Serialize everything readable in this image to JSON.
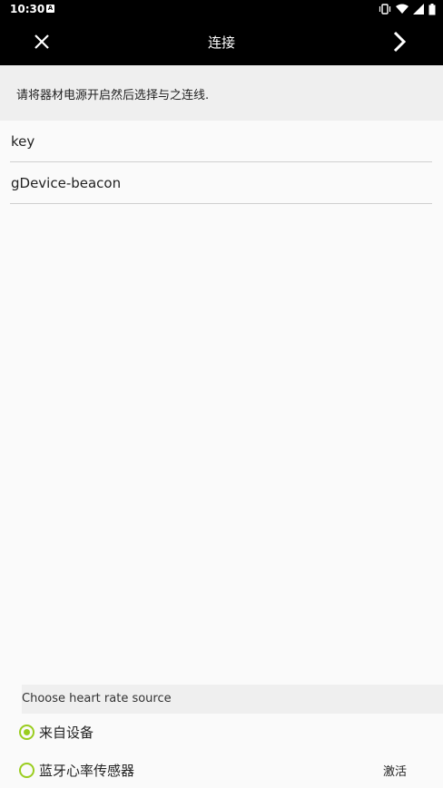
{
  "status_bar": {
    "time": "10:30",
    "notification_icon": "A",
    "icons": [
      "vibrate-icon",
      "wifi-icon",
      "signal-icon",
      "battery-icon"
    ]
  },
  "toolbar": {
    "title": "连接",
    "left_icon": "close-icon",
    "right_icon": "chevron-right-icon"
  },
  "instruction": "请将器材电源开启然后选择与之连线.",
  "devices": [
    "key",
    "gDevice-beacon"
  ],
  "heart_rate": {
    "header": "Choose heart rate source",
    "options": [
      {
        "label": "来自设备",
        "checked": true
      },
      {
        "label": "蓝牙心率传感器",
        "checked": false
      }
    ],
    "activate_label": "激活"
  },
  "colors": {
    "accent": "#9acd1f",
    "toolbar_bg": "#000000",
    "background": "#fafafa"
  }
}
